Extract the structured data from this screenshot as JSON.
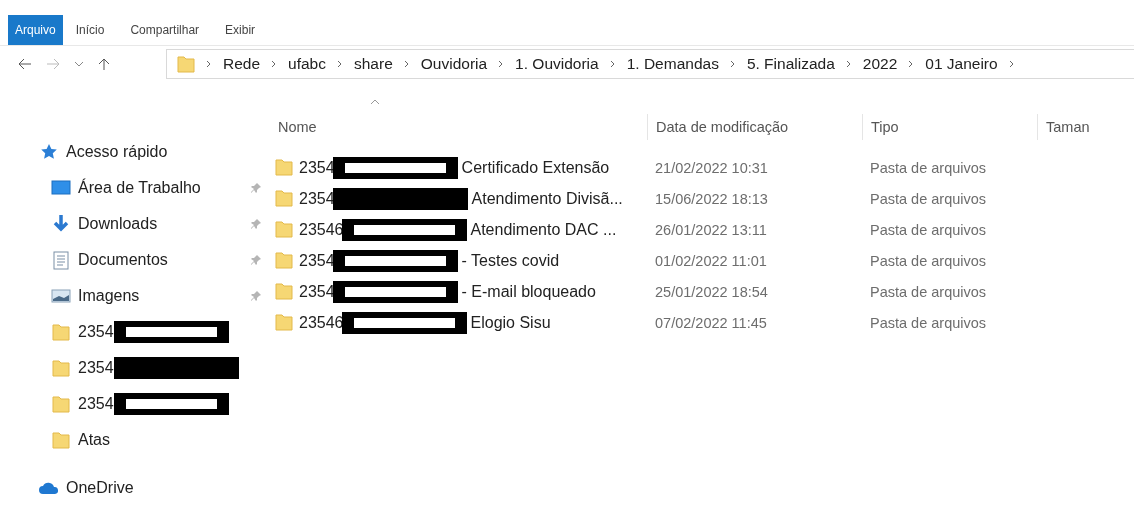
{
  "ribbon": {
    "tabs": [
      {
        "label": "Arquivo",
        "selected": true
      },
      {
        "label": "Início",
        "selected": false
      },
      {
        "label": "Compartilhar",
        "selected": false
      },
      {
        "label": "Exibir",
        "selected": false
      }
    ]
  },
  "address_bar": {
    "breadcrumbs": [
      "Rede",
      "ufabc",
      "share",
      "Ouvidoria",
      "1. Ouvidoria",
      "1. Demandas",
      "5. Finalizada",
      "2022",
      "01 Janeiro"
    ]
  },
  "navigation_pane": {
    "items": [
      {
        "label": "Acesso rápido",
        "kind": "star",
        "children": [
          {
            "label": "Área de Trabalho",
            "kind": "desktop",
            "pinned": true
          },
          {
            "label": "Downloads",
            "kind": "download",
            "pinned": true
          },
          {
            "label": "Documentos",
            "kind": "document",
            "pinned": true
          },
          {
            "label": "Imagens",
            "kind": "picture",
            "pinned": true
          },
          {
            "label": "2354",
            "kind": "redacted",
            "pinned": false,
            "redaction_filled": false
          },
          {
            "label": "2354",
            "kind": "redacted",
            "pinned": false,
            "redaction_filled": true
          },
          {
            "label": "2354",
            "kind": "redacted",
            "pinned": false,
            "redaction_filled": false
          },
          {
            "label": "Atas",
            "kind": "folder",
            "pinned": false
          }
        ]
      },
      {
        "label": "OneDrive",
        "kind": "cloud"
      }
    ]
  },
  "file_list": {
    "columns": [
      {
        "label": "Nome",
        "sorted": true
      },
      {
        "label": "Data de modificação",
        "sorted": false
      },
      {
        "label": "Tipo",
        "sorted": false
      },
      {
        "label": "Taman",
        "sorted": false
      }
    ],
    "rows": [
      {
        "name_prefix": "2354",
        "redaction_filled": false,
        "name_suffix": "Certificado Extensão",
        "modified": "21/02/2022 10:31",
        "type": "Pasta de arquivos"
      },
      {
        "name_prefix": "2354",
        "redaction_filled": true,
        "name_suffix": "Atendimento Divisã...",
        "modified": "15/06/2022 18:13",
        "type": "Pasta de arquivos"
      },
      {
        "name_prefix": "23546",
        "redaction_filled": false,
        "name_suffix": "Atendimento DAC ...",
        "modified": "26/01/2022 13:11",
        "type": "Pasta de arquivos"
      },
      {
        "name_prefix": "2354",
        "redaction_filled": false,
        "name_suffix": "- Testes covid",
        "modified": "01/02/2022 11:01",
        "type": "Pasta de arquivos"
      },
      {
        "name_prefix": "2354",
        "redaction_filled": false,
        "name_suffix": "- E-mail bloqueado",
        "modified": "25/01/2022 18:54",
        "type": "Pasta de arquivos"
      },
      {
        "name_prefix": "23546",
        "redaction_filled": false,
        "name_suffix": "Elogio Sisu",
        "modified": "07/02/2022 11:45",
        "type": "Pasta de arquivos"
      }
    ]
  }
}
